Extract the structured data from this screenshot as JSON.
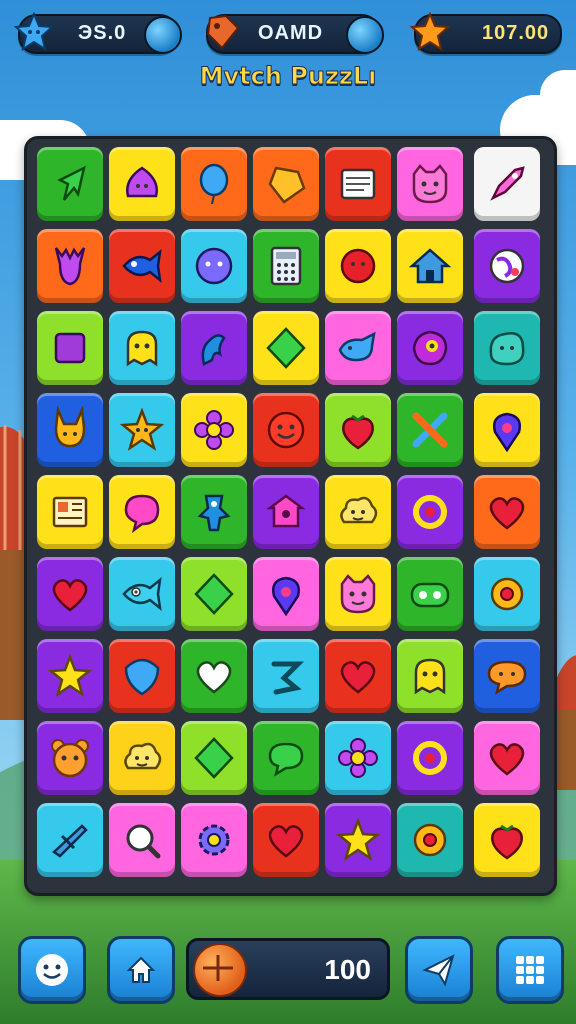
{
  "hud": {
    "left_value": "ЭS.0",
    "middle_value": "OAMD",
    "right_value": "107.00"
  },
  "title": "Mvtch PuzzLı",
  "coin_value": "100",
  "colors": {
    "green": "#2fb52a",
    "purple": "#8a2be2",
    "orange": "#ff6a1a",
    "red": "#e8321e",
    "pink": "#ff66e0",
    "white": "#f5f5f5",
    "yellow": "#ffe11a",
    "cyan": "#35c9ec",
    "lime": "#8ee02a",
    "blue": "#1f5fe0",
    "teal": "#1fb8b0",
    "gold": "#ffd21a"
  },
  "board": [
    [
      {
        "c": "green",
        "icon": "arrow-icon"
      },
      {
        "c": "yellow",
        "icon": "blob-icon"
      },
      {
        "c": "orange",
        "icon": "balloon-icon"
      },
      {
        "c": "orange",
        "icon": "gem-icon"
      },
      {
        "c": "red",
        "icon": "window-icon"
      },
      {
        "c": "pink",
        "icon": "cat-face-icon"
      },
      {
        "c": "white",
        "icon": "rocket-icon"
      }
    ],
    [
      {
        "c": "orange",
        "icon": "deer-icon"
      },
      {
        "c": "red",
        "icon": "fish-icon"
      },
      {
        "c": "cyan",
        "icon": "ball-face-icon"
      },
      {
        "c": "green",
        "icon": "calculator-icon"
      },
      {
        "c": "yellow",
        "icon": "red-blob-icon"
      },
      {
        "c": "yellow",
        "icon": "house-icon"
      },
      {
        "c": "purple",
        "icon": "globe-icon"
      }
    ],
    [
      {
        "c": "lime",
        "icon": "square-icon"
      },
      {
        "c": "cyan",
        "icon": "ghost-icon"
      },
      {
        "c": "purple",
        "icon": "squiggle-icon"
      },
      {
        "c": "yellow",
        "icon": "diamond-icon"
      },
      {
        "c": "pink",
        "icon": "whale-icon"
      },
      {
        "c": "purple",
        "icon": "eye-blob-icon"
      },
      {
        "c": "teal",
        "icon": "blob-face-icon"
      }
    ],
    [
      {
        "c": "blue",
        "icon": "bunny-icon"
      },
      {
        "c": "cyan",
        "icon": "star-face-icon"
      },
      {
        "c": "yellow",
        "icon": "flower-icon"
      },
      {
        "c": "red",
        "icon": "smile-icon"
      },
      {
        "c": "lime",
        "icon": "strawberry-icon"
      },
      {
        "c": "green",
        "icon": "cross-icon"
      },
      {
        "c": "yellow",
        "icon": "map-pin-icon"
      }
    ],
    [
      {
        "c": "yellow",
        "icon": "newspaper-icon"
      },
      {
        "c": "yellow",
        "icon": "chat-heart-icon"
      },
      {
        "c": "green",
        "icon": "robot-icon"
      },
      {
        "c": "purple",
        "icon": "birdhouse-icon"
      },
      {
        "c": "yellow",
        "icon": "cloud-face-icon"
      },
      {
        "c": "purple",
        "icon": "ring-icon"
      },
      {
        "c": "orange",
        "icon": "heart-icon"
      }
    ],
    [
      {
        "c": "purple",
        "icon": "heart-icon"
      },
      {
        "c": "cyan",
        "icon": "fish-eye-icon"
      },
      {
        "c": "lime",
        "icon": "diamond-icon"
      },
      {
        "c": "pink",
        "icon": "map-pin-icon"
      },
      {
        "c": "yellow",
        "icon": "cat-face-icon"
      },
      {
        "c": "green",
        "icon": "mask-icon"
      },
      {
        "c": "cyan",
        "icon": "donut-icon"
      }
    ],
    [
      {
        "c": "purple",
        "icon": "star-icon"
      },
      {
        "c": "red",
        "icon": "shield-icon"
      },
      {
        "c": "green",
        "icon": "white-heart-icon"
      },
      {
        "c": "cyan",
        "icon": "swirl-icon"
      },
      {
        "c": "red",
        "icon": "heart-icon"
      },
      {
        "c": "lime",
        "icon": "ghost-icon"
      },
      {
        "c": "blue",
        "icon": "chat-face-icon"
      }
    ],
    [
      {
        "c": "purple",
        "icon": "bear-icon"
      },
      {
        "c": "gold",
        "icon": "cloud-face-icon"
      },
      {
        "c": "lime",
        "icon": "diamond-icon"
      },
      {
        "c": "green",
        "icon": "speech-icon"
      },
      {
        "c": "cyan",
        "icon": "flower-icon"
      },
      {
        "c": "purple",
        "icon": "ring-icon"
      },
      {
        "c": "pink",
        "icon": "heart-icon"
      }
    ],
    [
      {
        "c": "cyan",
        "icon": "airplane-icon"
      },
      {
        "c": "pink",
        "icon": "magnifier-icon"
      },
      {
        "c": "pink",
        "icon": "gear-icon"
      },
      {
        "c": "red",
        "icon": "heart-icon"
      },
      {
        "c": "purple",
        "icon": "star-icon"
      },
      {
        "c": "teal",
        "icon": "donut-icon"
      },
      {
        "c": "yellow",
        "icon": "strawberry-icon"
      }
    ]
  ],
  "bottom_buttons": [
    {
      "name": "smiley-button",
      "icon": "smiley-icon"
    },
    {
      "name": "home-button",
      "icon": "home-arrow-icon"
    },
    {
      "name": "send-button",
      "icon": "paper-plane-icon"
    },
    {
      "name": "grid-menu-button",
      "icon": "grid-icon"
    }
  ]
}
